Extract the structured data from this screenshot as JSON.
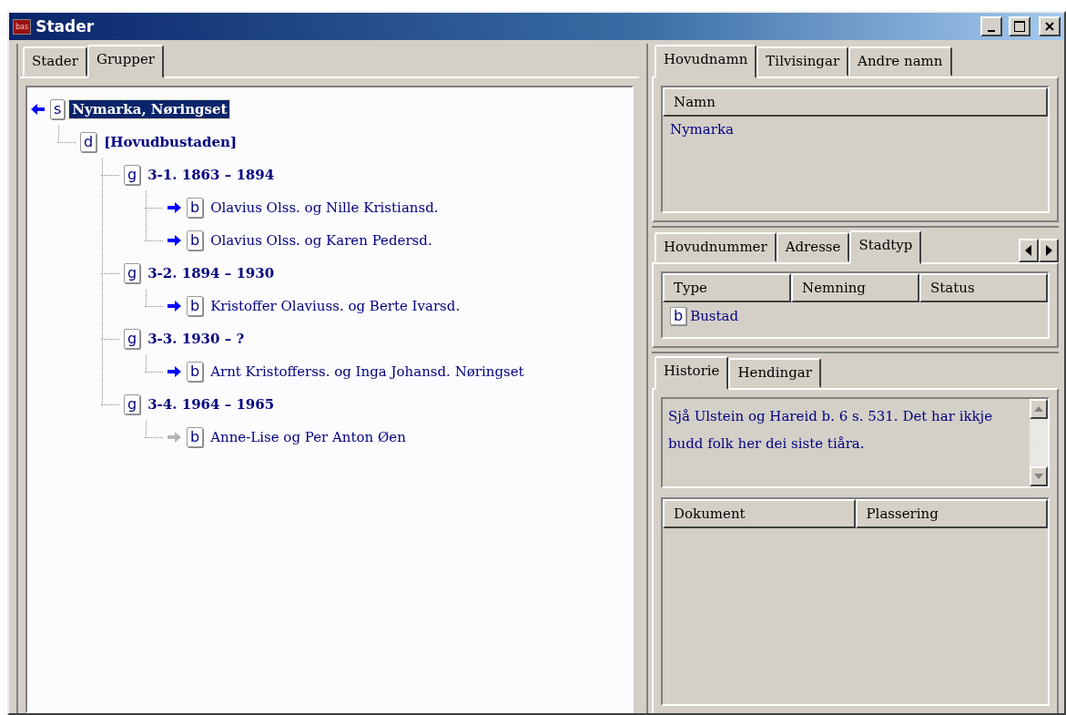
{
  "window": {
    "app_icon": "bas",
    "title": "Stader"
  },
  "left_tabs": [
    {
      "label": "Stader",
      "selected": false
    },
    {
      "label": "Grupper",
      "selected": true
    }
  ],
  "tree": [
    {
      "badge": "s",
      "label": "Nymarka, Nøringset",
      "kind": "root",
      "arrow": {
        "kind": "left",
        "dimmed": false
      },
      "selected": true,
      "children": [
        {
          "badge": "d",
          "label": "[Hovudbustaden]",
          "kind": "group",
          "selected": false,
          "children": [
            {
              "badge": "g",
              "label": "3-1. 1863 – 1894",
              "kind": "group",
              "selected": false,
              "children": [
                {
                  "badge": "b",
                  "label": "Olavius Olss. og Nille Kristiansd.",
                  "kind": "person",
                  "arrow": {
                    "kind": "right",
                    "dimmed": false
                  },
                  "selected": false
                },
                {
                  "badge": "b",
                  "label": "Olavius Olss. og Karen Pedersd.",
                  "kind": "person",
                  "arrow": {
                    "kind": "right",
                    "dimmed": false
                  },
                  "selected": false
                }
              ]
            },
            {
              "badge": "g",
              "label": "3-2. 1894 – 1930",
              "kind": "group",
              "selected": false,
              "children": [
                {
                  "badge": "b",
                  "label": "Kristoffer Olaviuss. og Berte Ivarsd.",
                  "kind": "person",
                  "arrow": {
                    "kind": "right",
                    "dimmed": false
                  },
                  "selected": false
                }
              ]
            },
            {
              "badge": "g",
              "label": "3-3. 1930 – ?",
              "kind": "group",
              "selected": false,
              "children": [
                {
                  "badge": "b",
                  "label": "Arnt Kristofferss. og Inga Johansd. Nøringset",
                  "kind": "person",
                  "arrow": {
                    "kind": "right",
                    "dimmed": false
                  },
                  "selected": false
                }
              ]
            },
            {
              "badge": "g",
              "label": "3-4. 1964 – 1965",
              "kind": "group",
              "selected": false,
              "children": [
                {
                  "badge": "b",
                  "label": "Anne-Lise og Per Anton Øen",
                  "kind": "person",
                  "arrow": {
                    "kind": "right",
                    "dimmed": true
                  },
                  "selected": false
                }
              ]
            }
          ]
        }
      ]
    }
  ],
  "name_tabs": [
    {
      "label": "Hovudnamn",
      "selected": true
    },
    {
      "label": "Tilvisingar",
      "selected": false
    },
    {
      "label": "Andre namn",
      "selected": false
    }
  ],
  "names": {
    "columns": [
      "Namn"
    ],
    "rows": [
      {
        "cells": [
          "Nymarka"
        ]
      }
    ]
  },
  "number_tabs": [
    {
      "label": "Hovudnummer",
      "selected": false
    },
    {
      "label": "Adresse",
      "selected": false
    },
    {
      "label": "Stadtyp",
      "selected": true
    }
  ],
  "types": {
    "columns": [
      "Type",
      "Nemning",
      "Status"
    ],
    "rows": [
      {
        "badge": "b",
        "cells": [
          "Bustad"
        ]
      }
    ]
  },
  "history_tabs": [
    {
      "label": "Historie",
      "selected": true
    },
    {
      "label": "Hendingar",
      "selected": false
    }
  ],
  "history_text": "Sjå Ulstein og Hareid b. 6 s. 531. Det har ikkje budd folk her dei siste tiåra.",
  "documents": {
    "columns": [
      "Dokument",
      "Plassering"
    ]
  }
}
